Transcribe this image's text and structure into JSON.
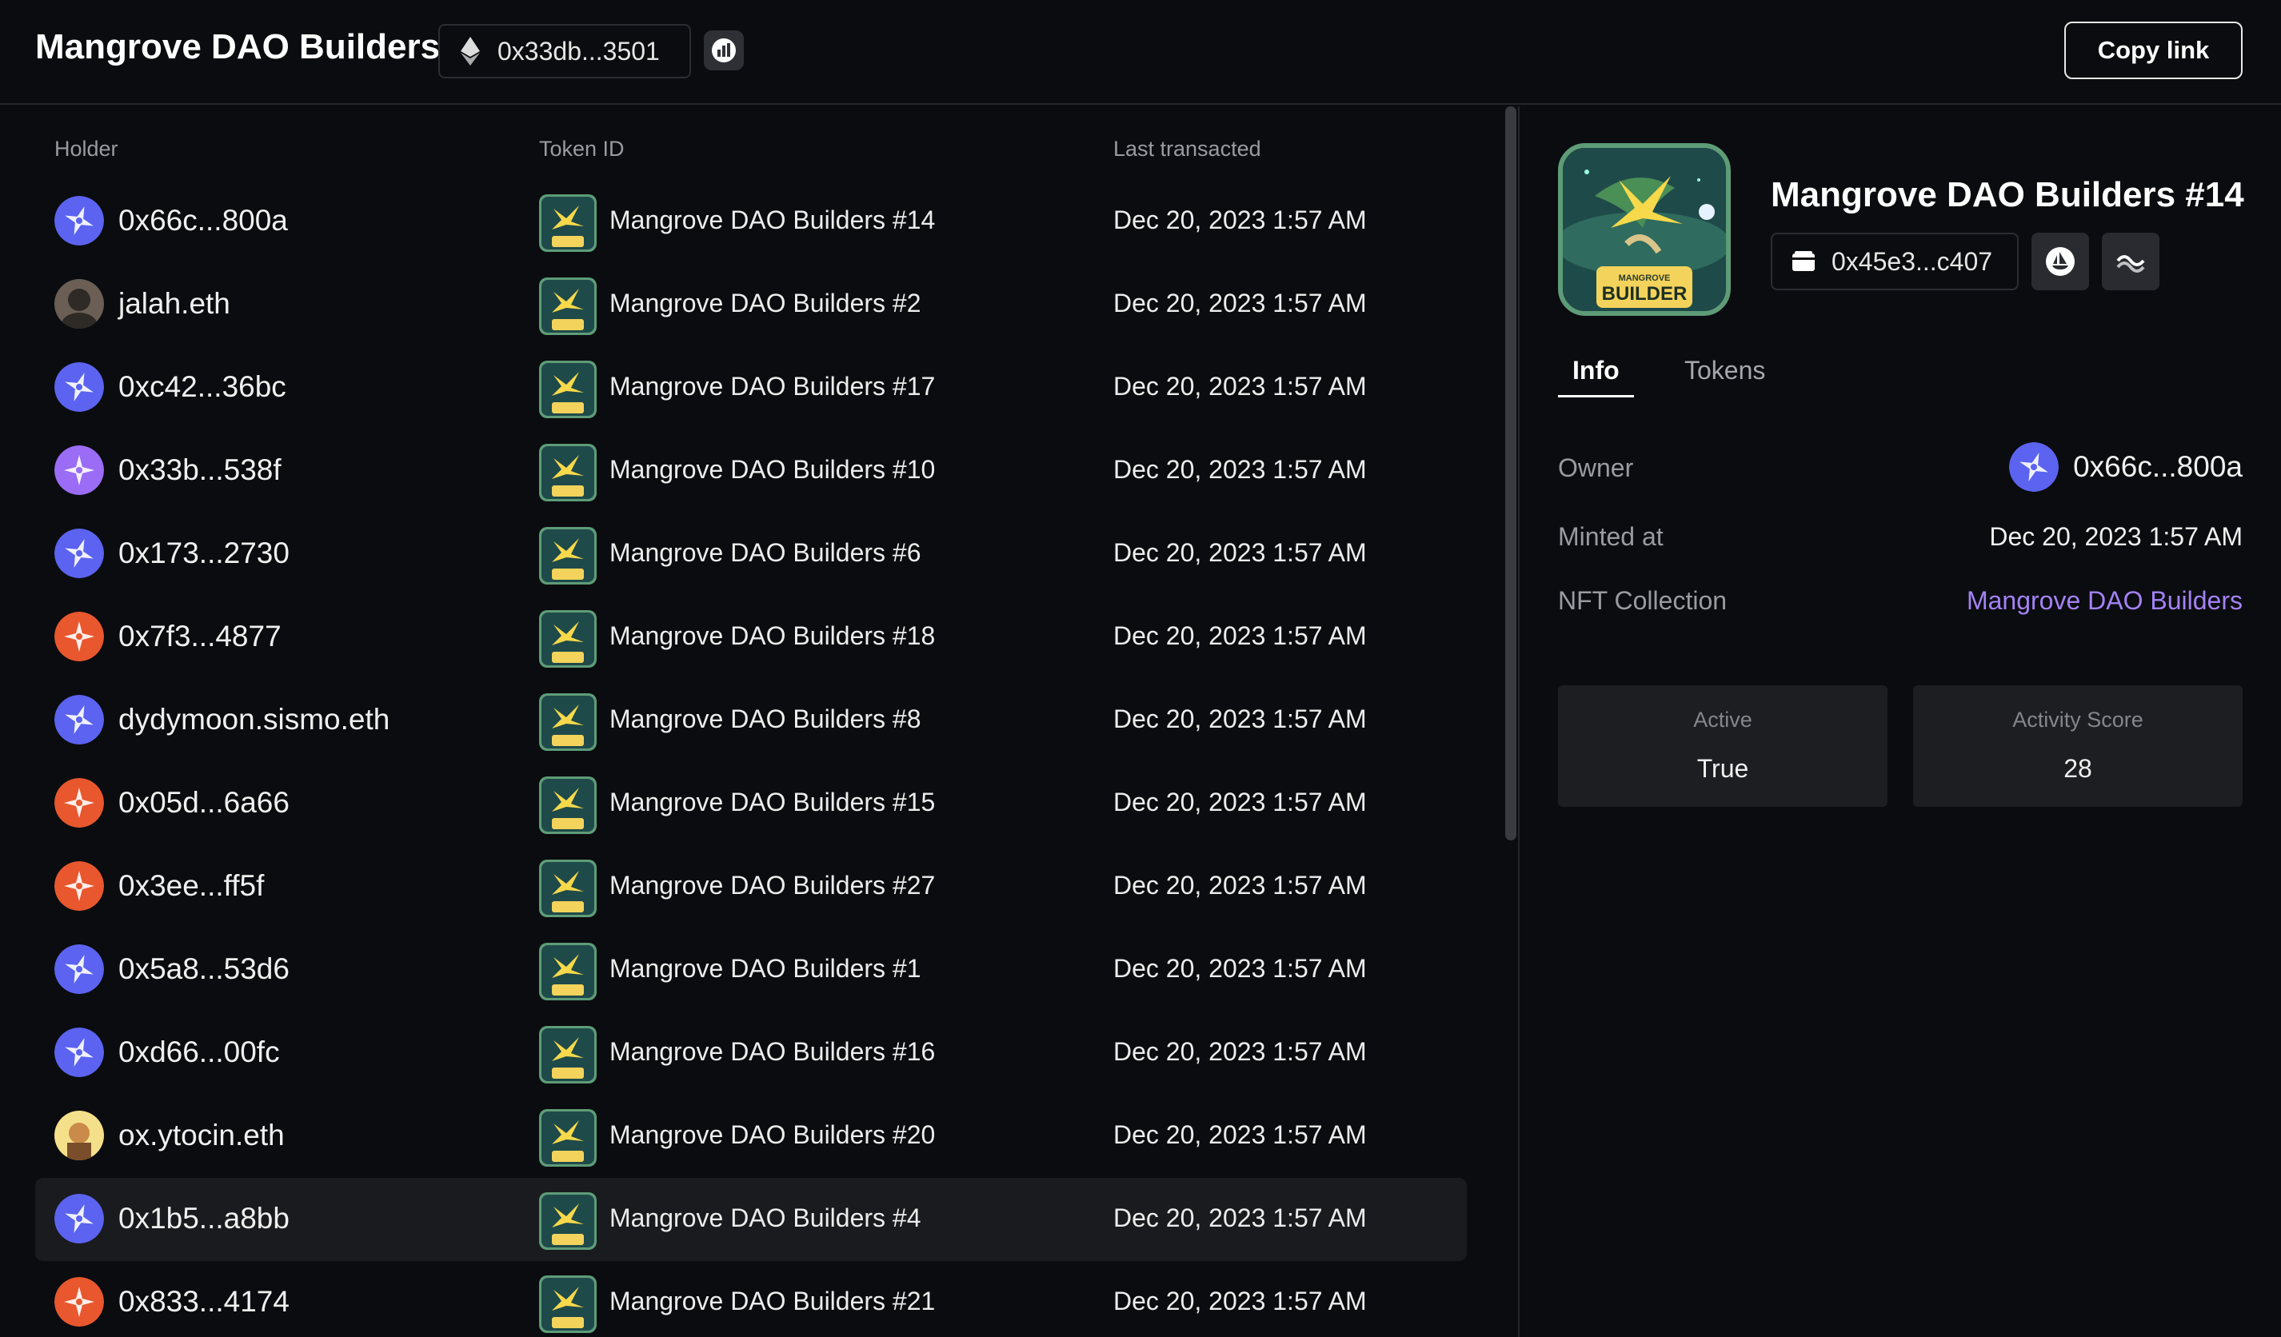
{
  "header": {
    "title": "Mangrove DAO Builders",
    "contract_short": "0x33db...3501",
    "copy_label": "Copy link",
    "network_icon": "ethereum-icon",
    "stats_icon": "analytics-icon"
  },
  "table": {
    "columns": [
      "Holder",
      "Token ID",
      "Last transacted"
    ],
    "rows": [
      {
        "holder": "0x66c...800a",
        "token": "Mangrove DAO Builders #14",
        "date": "Dec 20, 2023 1:57 AM",
        "avatar": "blue"
      },
      {
        "holder": "jalah.eth",
        "token": "Mangrove DAO Builders #2",
        "date": "Dec 20, 2023 1:57 AM",
        "avatar": "photo"
      },
      {
        "holder": "0xc42...36bc",
        "token": "Mangrove DAO Builders #17",
        "date": "Dec 20, 2023 1:57 AM",
        "avatar": "blue"
      },
      {
        "holder": "0x33b...538f",
        "token": "Mangrove DAO Builders #10",
        "date": "Dec 20, 2023 1:57 AM",
        "avatar": "purple"
      },
      {
        "holder": "0x173...2730",
        "token": "Mangrove DAO Builders #6",
        "date": "Dec 20, 2023 1:57 AM",
        "avatar": "blue"
      },
      {
        "holder": "0x7f3...4877",
        "token": "Mangrove DAO Builders #18",
        "date": "Dec 20, 2023 1:57 AM",
        "avatar": "orange"
      },
      {
        "holder": "dydymoon.sismo.eth",
        "token": "Mangrove DAO Builders #8",
        "date": "Dec 20, 2023 1:57 AM",
        "avatar": "blue"
      },
      {
        "holder": "0x05d...6a66",
        "token": "Mangrove DAO Builders #15",
        "date": "Dec 20, 2023 1:57 AM",
        "avatar": "orange"
      },
      {
        "holder": "0x3ee...ff5f",
        "token": "Mangrove DAO Builders #27",
        "date": "Dec 20, 2023 1:57 AM",
        "avatar": "orange"
      },
      {
        "holder": "0x5a8...53d6",
        "token": "Mangrove DAO Builders #1",
        "date": "Dec 20, 2023 1:57 AM",
        "avatar": "blue"
      },
      {
        "holder": "0xd66...00fc",
        "token": "Mangrove DAO Builders #16",
        "date": "Dec 20, 2023 1:57 AM",
        "avatar": "blue"
      },
      {
        "holder": "ox.ytocin.eth",
        "token": "Mangrove DAO Builders #20",
        "date": "Dec 20, 2023 1:57 AM",
        "avatar": "yellow"
      },
      {
        "holder": "0x1b5...a8bb",
        "token": "Mangrove DAO Builders #4",
        "date": "Dec 20, 2023 1:57 AM",
        "avatar": "blue",
        "selected": true
      },
      {
        "holder": "0x833...4174",
        "token": "Mangrove DAO Builders #21",
        "date": "Dec 20, 2023 1:57 AM",
        "avatar": "orange"
      }
    ]
  },
  "detail": {
    "title": "Mangrove DAO Builders #14",
    "contract_short": "0x45e3...c407",
    "badge_small": "MANGROVE",
    "badge_big": "BUILDER",
    "tabs": [
      "Info",
      "Tokens"
    ],
    "owner_label": "Owner",
    "owner_value": "0x66c...800a",
    "minted_label": "Minted at",
    "minted_value": "Dec 20, 2023 1:57 AM",
    "collection_label": "NFT Collection",
    "collection_value": "Mangrove DAO Builders",
    "stats": [
      {
        "label": "Active",
        "value": "True"
      },
      {
        "label": "Activity Score",
        "value": "28"
      }
    ]
  },
  "colors": {
    "background": "#0b0c0f",
    "accent_link": "#a382f5",
    "avatar_blue": "#5b63f0",
    "avatar_purple": "#9b6cf5",
    "avatar_orange": "#e8572e"
  }
}
